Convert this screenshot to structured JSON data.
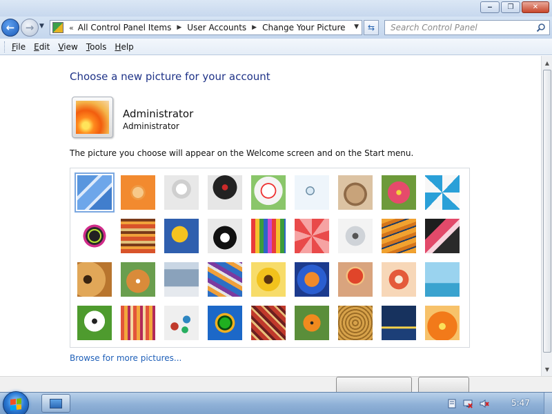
{
  "window": {
    "minimize": "‒",
    "maximize": "❐",
    "close": "✕"
  },
  "address_bar": {
    "back": "←",
    "forward": "→",
    "overflow": "«",
    "crumbs": [
      "All Control Panel Items",
      "User Accounts",
      "Change Your Picture"
    ],
    "refresh": "⇆"
  },
  "search": {
    "placeholder": "Search Control Panel"
  },
  "menu": [
    {
      "label": "File",
      "accel": "F",
      "rest": "ile"
    },
    {
      "label": "Edit",
      "accel": "E",
      "rest": "dit"
    },
    {
      "label": "View",
      "accel": "V",
      "rest": "iew"
    },
    {
      "label": "Tools",
      "accel": "T",
      "rest": "ools"
    },
    {
      "label": "Help",
      "accel": "H",
      "rest": "elp"
    }
  ],
  "content": {
    "title": "Choose a new picture for your account",
    "user_name": "Administrator",
    "user_type": "Administrator",
    "description": "The picture you choose will appear on the Welcome screen and on the Start menu.",
    "browse_link": "Browse for more pictures..."
  },
  "pictures": [
    {
      "name": "roller-coaster",
      "selected": true
    },
    {
      "name": "starfish"
    },
    {
      "name": "robot-figure"
    },
    {
      "name": "turntable"
    },
    {
      "name": "lucky-cat"
    },
    {
      "name": "gyroscope"
    },
    {
      "name": "kitten"
    },
    {
      "name": "pink-flower"
    },
    {
      "name": "pinwheel"
    },
    {
      "name": "ball"
    },
    {
      "name": "fabric"
    },
    {
      "name": "ginkgo-leaf"
    },
    {
      "name": "dog"
    },
    {
      "name": "crayons"
    },
    {
      "name": "paper-star"
    },
    {
      "name": "jacks"
    },
    {
      "name": "stairs"
    },
    {
      "name": "origami-crane"
    },
    {
      "name": "guitar"
    },
    {
      "name": "pomeranian"
    },
    {
      "name": "toy-robot"
    },
    {
      "name": "silk"
    },
    {
      "name": "sunflower"
    },
    {
      "name": "fish"
    },
    {
      "name": "hot-air-balloon"
    },
    {
      "name": "doll"
    },
    {
      "name": "sailboat"
    },
    {
      "name": "soccer-ball"
    },
    {
      "name": "textile"
    },
    {
      "name": "marbles"
    },
    {
      "name": "window"
    },
    {
      "name": "rug"
    },
    {
      "name": "butterfly"
    },
    {
      "name": "basket"
    },
    {
      "name": "lighthouse"
    },
    {
      "name": "orange-flower"
    }
  ],
  "taskbar": {
    "clock": "5:47"
  }
}
